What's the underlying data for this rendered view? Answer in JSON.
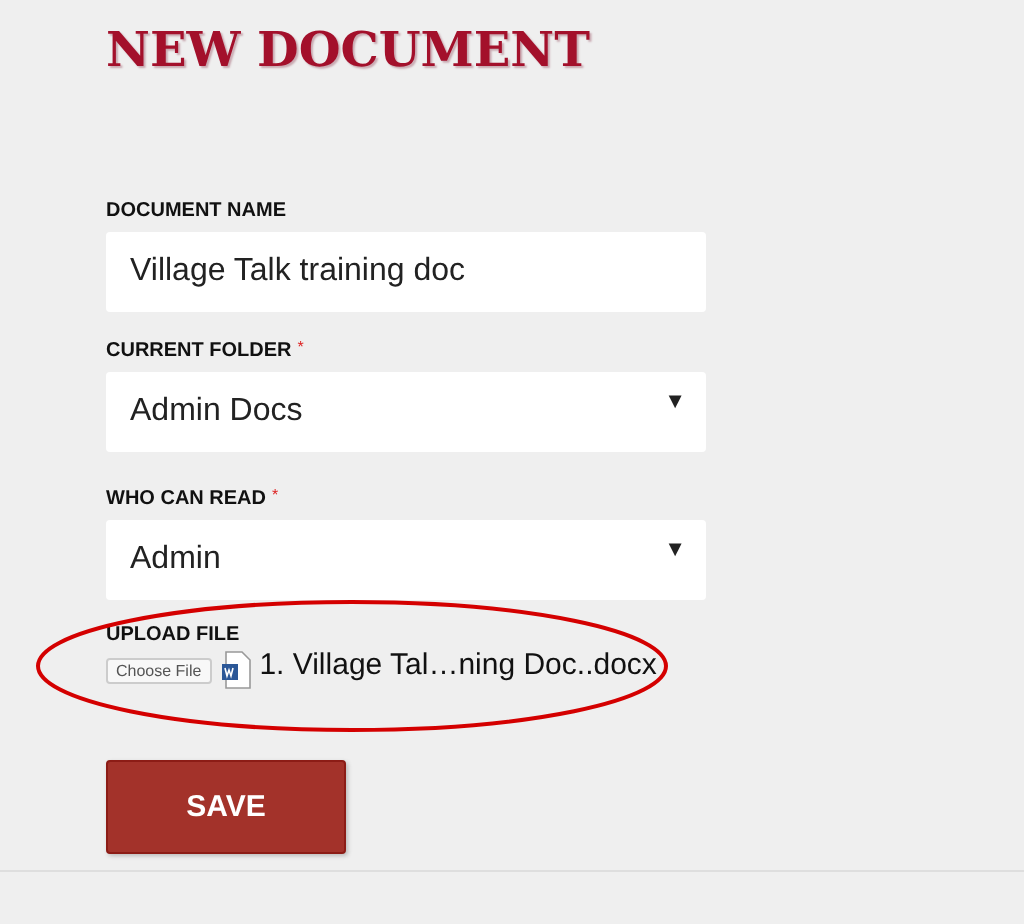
{
  "title": "NEW DOCUMENT",
  "fields": [
    {
      "kind": "text",
      "label": "DOCUMENT NAME",
      "value": "Village Talk training doc"
    },
    {
      "kind": "select",
      "label": "CURRENT FOLDER",
      "required_mark": "*",
      "value": "Admin Docs",
      "arrow": "▼"
    },
    {
      "kind": "select",
      "label": "WHO CAN READ",
      "required_mark": "*",
      "value": "Admin",
      "arrow": "▼"
    }
  ],
  "upload": {
    "label": "UPLOAD FILE",
    "button": "Choose File",
    "file_name": "1. Village Tal…ning Doc..docx",
    "highlighted": true
  },
  "save_button": "SAVE"
}
